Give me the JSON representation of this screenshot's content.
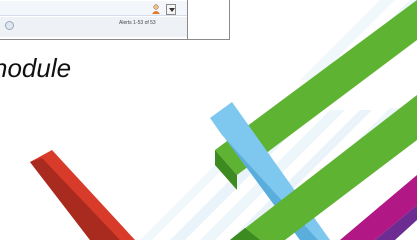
{
  "screenshot": {
    "status_text": "Alerts 1-53 of 53"
  },
  "slide": {
    "heading_fragment": "nodule"
  },
  "icons": {
    "avatar": "user-avatar-icon",
    "dropdown": "chevron-down-icon",
    "circle": "circle-button-icon"
  },
  "colors": {
    "green": "#5fb332",
    "red": "#d93b2b",
    "sky_blue": "#7ec8ef",
    "magenta": "#b11785",
    "purple": "#6d2c91",
    "light_stripe": "#d8eaf6"
  }
}
